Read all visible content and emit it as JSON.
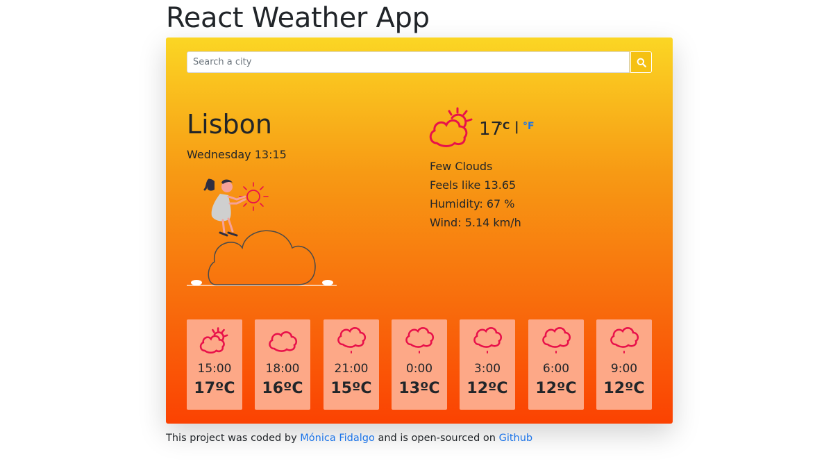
{
  "app": {
    "title": "React Weather App"
  },
  "search": {
    "placeholder": "Search a city"
  },
  "current": {
    "city": "Lisbon",
    "date_time": "Wednesday 13:15",
    "temperature": "17",
    "unit_celsius": "°C",
    "unit_separator": "|",
    "unit_fahrenheit": "°F",
    "description": "Few Clouds",
    "feels_like": "Feels like 13.65",
    "humidity": "Humidity: 67 %",
    "wind": "Wind: 5.14 km/h",
    "icon": "sun-behind-cloud-icon"
  },
  "forecast": [
    {
      "time": "15:00",
      "temp": "17ºC",
      "icon": "sun-behind-cloud-icon"
    },
    {
      "time": "18:00",
      "temp": "16ºC",
      "icon": "cloud-icon"
    },
    {
      "time": "21:00",
      "temp": "15ºC",
      "icon": "rain-cloud-icon"
    },
    {
      "time": "0:00",
      "temp": "13ºC",
      "icon": "rain-cloud-icon"
    },
    {
      "time": "3:00",
      "temp": "12ºC",
      "icon": "rain-cloud-icon"
    },
    {
      "time": "6:00",
      "temp": "12ºC",
      "icon": "rain-cloud-icon"
    },
    {
      "time": "9:00",
      "temp": "12ºC",
      "icon": "rain-cloud-icon"
    }
  ],
  "footer": {
    "prefix": "This project was coded by",
    "author": "Mónica Fidalgo",
    "middle": "and is open-sourced on",
    "repo": "Github"
  },
  "colors": {
    "accent": "#f5c113",
    "link": "#1a73e8",
    "icon": "#e8114a",
    "card_tile": "#fda887"
  }
}
